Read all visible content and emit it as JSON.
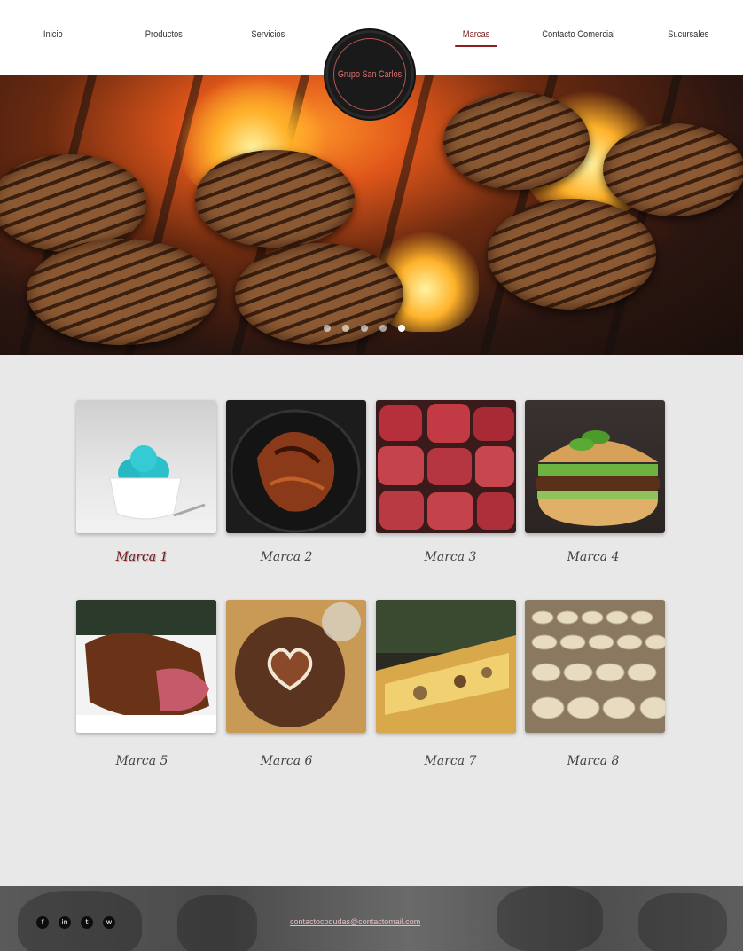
{
  "nav": {
    "items": [
      "Inicio",
      "Productos",
      "Servicios",
      "Marcas",
      "Contacto Comercial",
      "Sucursales"
    ],
    "active": "Marcas"
  },
  "logo": {
    "text": "Grupo San Carlos"
  },
  "hero": {
    "slides": 5,
    "active_slide": 5
  },
  "brands": [
    {
      "label": "Marca 1",
      "image": "turquoise ice cream in white bowl",
      "active": true
    },
    {
      "label": "Marca 2",
      "image": "roast chicken in cast iron pan"
    },
    {
      "label": "Marca 3",
      "image": "raw beef steaks"
    },
    {
      "label": "Marca 4",
      "image": "burger with basil"
    },
    {
      "label": "Marca 5",
      "image": "sliced roast beef"
    },
    {
      "label": "Marca 6",
      "image": "chocolate cake with sugar heart"
    },
    {
      "label": "Marca 7",
      "image": "pizza slice"
    },
    {
      "label": "Marca 8",
      "image": "cheese wheels on shelves"
    }
  ],
  "footer": {
    "social": [
      {
        "name": "facebook-icon",
        "glyph": "f"
      },
      {
        "name": "linkedin-icon",
        "glyph": "in"
      },
      {
        "name": "twitter-icon",
        "glyph": "t"
      },
      {
        "name": "whatsapp-icon",
        "glyph": "w"
      }
    ],
    "email": "contactocodudas@contactomail.com"
  },
  "colors": {
    "accent": "#8b1e1e",
    "header_bg": "#ffffff",
    "page_bg": "#e8e8e8",
    "logo_text": "#d97070"
  }
}
